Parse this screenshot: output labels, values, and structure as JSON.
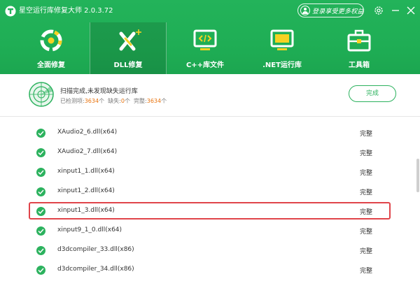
{
  "app": {
    "title": "星空运行库修复大师 2.0.3.72"
  },
  "login": {
    "label": "登录享受更多权益"
  },
  "nav": {
    "items": [
      {
        "label": "全面修复"
      },
      {
        "label": "DLL修复"
      },
      {
        "label": "C++库文件"
      },
      {
        "label": ".NET运行库"
      },
      {
        "label": "工具箱"
      }
    ],
    "active_index": 1
  },
  "status": {
    "title": "扫描完成,未发现缺失运行库",
    "detected_label": "已检测项:",
    "detected_count": "3634",
    "unit": "个",
    "missing_label": "缺失:",
    "missing_count": "0",
    "complete_label": "完整:",
    "complete_count": "3634",
    "button": "完成"
  },
  "list": {
    "rows": [
      {
        "name": "XAudio2_6.dll(x64)",
        "status": "完整"
      },
      {
        "name": "XAudio2_7.dll(x64)",
        "status": "完整"
      },
      {
        "name": "xinput1_1.dll(x64)",
        "status": "完整"
      },
      {
        "name": "xinput1_2.dll(x64)",
        "status": "完整"
      },
      {
        "name": "xinput1_3.dll(x64)",
        "status": "完整"
      },
      {
        "name": "xinput9_1_0.dll(x64)",
        "status": "完整"
      },
      {
        "name": "d3dcompiler_33.dll(x86)",
        "status": "完整"
      },
      {
        "name": "d3dcompiler_34.dll(x86)",
        "status": "完整"
      }
    ],
    "highlighted_index": 4
  },
  "colors": {
    "brand_green": "#23b35a",
    "accent_orange": "#e8720c",
    "highlight_red": "#e0444a"
  },
  "icons": {
    "logo": "app-logo-icon",
    "nav": [
      "recycle-repair-icon",
      "dll-tools-icon",
      "code-window-icon",
      "dotnet-window-icon",
      "toolbox-icon"
    ]
  }
}
